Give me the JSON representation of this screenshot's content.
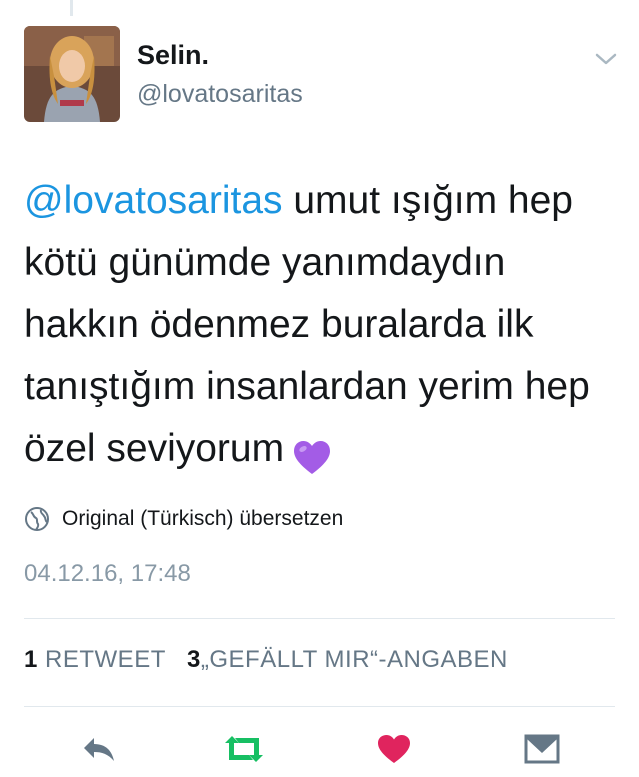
{
  "author": {
    "display_name": "Selin.",
    "handle": "@lovatosaritas"
  },
  "tweet": {
    "mention": "@lovatosaritas",
    "text": " umut ışığım hep kötü günümde yanımdaydın hakkın ödenmez buralarda ilk tanıştığım insanlardan yerim hep özel seviyorum",
    "emoji": "purple-heart"
  },
  "translate": {
    "label": "Original (Türkisch) übersetzen"
  },
  "timestamp": "04.12.16, 17:48",
  "stats": {
    "retweet_count": "1",
    "retweet_label": "RETWEET",
    "likes_count": "3",
    "likes_label": "„GEFÄLLT MIR“-ANGABEN"
  },
  "actions": {
    "reply_icon": "reply-icon",
    "retweet_icon": "retweet-icon",
    "like_icon": "heart-icon",
    "dm_icon": "envelope-icon"
  },
  "colors": {
    "mention": "#1b95e0",
    "retweet_active": "#17bf63",
    "like_active": "#e0245e",
    "muted": "#657786"
  }
}
